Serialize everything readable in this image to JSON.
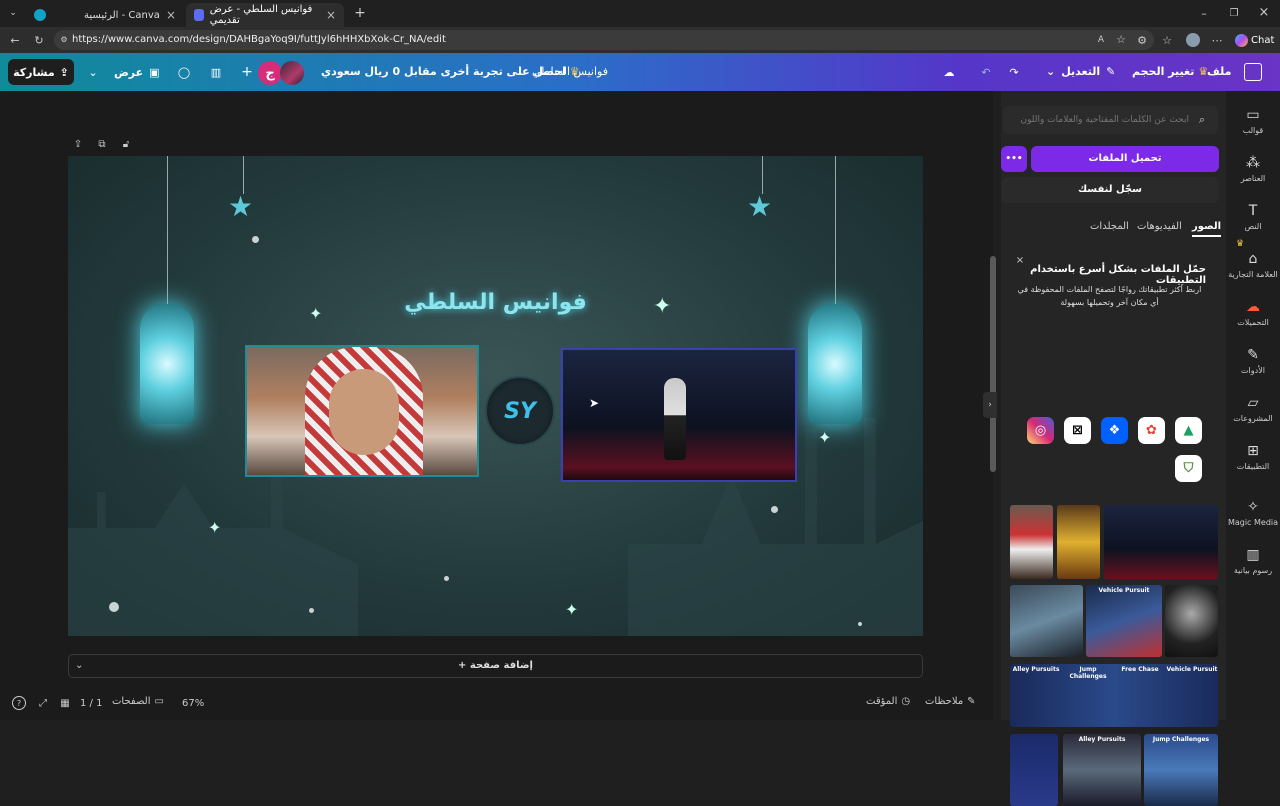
{
  "browser": {
    "tabs": [
      {
        "label": "الرئيسية - Canva"
      },
      {
        "label": "فوانيس السلطي - عرض تقديمي"
      }
    ],
    "url": "https://www.canva.com/design/DAHBgaYoq9I/futtJyl6hHHXbXok-Cr_NA/edit",
    "copilot_label": "Chat"
  },
  "toolbar": {
    "file": "ملف",
    "resize": "تغيير الحجم",
    "edit": "التعديل",
    "design_name": "فوانيس السلطي",
    "trial_offer": "احصل على تجربة أخرى مقابل 0 ريال سعودي",
    "avatar_letter": "ج",
    "present": "عرض",
    "share": "مشاركة"
  },
  "canvas": {
    "title": "فوانيس السلطي",
    "logo_text": "SY"
  },
  "editor": {
    "add_page": "+ إضافة صفحة",
    "notes": "ملاحظات",
    "timer": "المؤقت",
    "pages_label": "الصفحات",
    "page_counter": "1 / 1",
    "zoom": "67%"
  },
  "panel": {
    "search_placeholder": "ابحث عن الكلمات المفتاحية والعلامات واللون",
    "upload_button": "تحميل الملفات",
    "more_button": "•••",
    "record_button": "سجّل لنفسك",
    "tabs": [
      "الصور",
      "الفيديوهات",
      "المجلدات"
    ],
    "promo_title": "حمّل الملفات بشكل أسرع باستخدام التطبيقات",
    "promo_body": "اربط أكثر تطبيقاتك رواجًا لتصفح الملفات المحفوظة في أي مكان آخر وتحميلها بسهولة",
    "thumb_labels": [
      "Vehicle Pursuit",
      "Alley Pursuits",
      "Jump Challenges",
      "Free Chase",
      "Vehicle Pursuit",
      "Alley Pursuits",
      "Jump Challenges"
    ]
  },
  "rail": [
    {
      "label": "قوالب",
      "icon": "templates-icon"
    },
    {
      "label": "العناصر",
      "icon": "elements-icon"
    },
    {
      "label": "النص",
      "icon": "text-icon"
    },
    {
      "label": "العلامة التجارية",
      "icon": "brand-icon"
    },
    {
      "label": "التحميلات",
      "icon": "uploads-icon"
    },
    {
      "label": "الأدوات",
      "icon": "draw-icon"
    },
    {
      "label": "المشروعات",
      "icon": "projects-icon"
    },
    {
      "label": "التطبيقات",
      "icon": "apps-icon"
    },
    {
      "label": "Magic Media",
      "icon": "magic-media-icon"
    },
    {
      "label": "رسوم بيانية",
      "icon": "charts-icon"
    }
  ],
  "colors": {
    "accent": "#7d2ae8",
    "toolbar_start": "#0f8b99",
    "toolbar_end": "#6a34c6",
    "canvas_bg": "#2a4244"
  }
}
